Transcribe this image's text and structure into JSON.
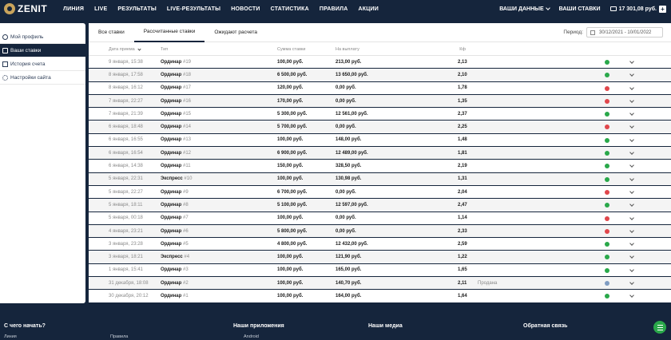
{
  "brand": {
    "name": "ZENIT"
  },
  "nav": [
    "ЛИНИЯ",
    "LIVE",
    "РЕЗУЛЬТАТЫ",
    "LIVE-РЕЗУЛЬТАТЫ",
    "НОВОСТИ",
    "СТАТИСТИКА",
    "ПРАВИЛА",
    "АКЦИИ"
  ],
  "header": {
    "my_data": "ВАШИ ДАННЫЕ",
    "my_bets": "ВАШИ СТАВКИ",
    "balance": "17 301,08 руб."
  },
  "sidebar": {
    "items": [
      {
        "label": "Мой профиль",
        "icon": "user-icon",
        "active": false
      },
      {
        "label": "Ваши ставки",
        "icon": "card-icon",
        "active": true
      },
      {
        "label": "История счета",
        "icon": "document-icon",
        "active": false
      },
      {
        "label": "Настройки сайта",
        "icon": "gear-icon",
        "active": false
      }
    ]
  },
  "tabs": [
    {
      "label": "Все ставки",
      "active": false
    },
    {
      "label": "Рассчитанные ставки",
      "active": true
    },
    {
      "label": "Ожидают расчета",
      "active": false
    }
  ],
  "period": {
    "label": "Период:",
    "value": "30/12/2021 - 10/01/2022"
  },
  "table": {
    "headers": {
      "date": "Дата приема",
      "type": "Тип",
      "amount": "Сумма ставки",
      "payout": "На выплату",
      "coef": "Кф"
    },
    "rows": [
      {
        "date": "9 января, 15:38",
        "type": "Ординар",
        "num": "#19",
        "amount": "100,00 руб.",
        "payout": "213,00 руб.",
        "coef": "2,13",
        "state": "",
        "status": "win"
      },
      {
        "date": "8 января, 17:58",
        "type": "Ординар",
        "num": "#18",
        "amount": "6 500,00 руб.",
        "payout": "13 650,00 руб.",
        "coef": "2,10",
        "state": "",
        "status": "win"
      },
      {
        "date": "8 января, 16:12",
        "type": "Ординар",
        "num": "#17",
        "amount": "120,00 руб.",
        "payout": "0,00 руб.",
        "coef": "1,78",
        "state": "",
        "status": "lose"
      },
      {
        "date": "7 января, 22:27",
        "type": "Ординар",
        "num": "#16",
        "amount": "170,00 руб.",
        "payout": "0,00 руб.",
        "coef": "1,35",
        "state": "",
        "status": "lose"
      },
      {
        "date": "7 января, 21:39",
        "type": "Ординар",
        "num": "#15",
        "amount": "5 300,00 руб.",
        "payout": "12 561,00 руб.",
        "coef": "2,37",
        "state": "",
        "status": "win"
      },
      {
        "date": "6 января, 18:48",
        "type": "Ординар",
        "num": "#14",
        "amount": "5 700,00 руб.",
        "payout": "0,00 руб.",
        "coef": "2,25",
        "state": "",
        "status": "lose"
      },
      {
        "date": "6 января, 16:55",
        "type": "Ординар",
        "num": "#13",
        "amount": "100,00 руб.",
        "payout": "148,00 руб.",
        "coef": "1,48",
        "state": "",
        "status": "win"
      },
      {
        "date": "6 января, 16:54",
        "type": "Ординар",
        "num": "#12",
        "amount": "6 900,00 руб.",
        "payout": "12 489,00 руб.",
        "coef": "1,81",
        "state": "",
        "status": "win"
      },
      {
        "date": "6 января, 14:38",
        "type": "Ординар",
        "num": "#11",
        "amount": "150,00 руб.",
        "payout": "328,50 руб.",
        "coef": "2,19",
        "state": "",
        "status": "win"
      },
      {
        "date": "5 января, 22:31",
        "type": "Экспресс",
        "num": "#10",
        "amount": "100,00 руб.",
        "payout": "130,98 руб.",
        "coef": "1,31",
        "state": "",
        "status": "win"
      },
      {
        "date": "5 января, 22:27",
        "type": "Ординар",
        "num": "#9",
        "amount": "6 700,00 руб.",
        "payout": "0,00 руб.",
        "coef": "2,04",
        "state": "",
        "status": "lose"
      },
      {
        "date": "5 января, 18:11",
        "type": "Ординар",
        "num": "#8",
        "amount": "5 100,00 руб.",
        "payout": "12 597,00 руб.",
        "coef": "2,47",
        "state": "",
        "status": "win"
      },
      {
        "date": "5 января, 00:18",
        "type": "Ординар",
        "num": "#7",
        "amount": "100,00 руб.",
        "payout": "0,00 руб.",
        "coef": "1,14",
        "state": "",
        "status": "lose"
      },
      {
        "date": "4 января, 23:21",
        "type": "Ординар",
        "num": "#6",
        "amount": "5 800,00 руб.",
        "payout": "0,00 руб.",
        "coef": "2,33",
        "state": "",
        "status": "lose"
      },
      {
        "date": "3 января, 23:28",
        "type": "Ординар",
        "num": "#5",
        "amount": "4 800,00 руб.",
        "payout": "12 432,00 руб.",
        "coef": "2,59",
        "state": "",
        "status": "win"
      },
      {
        "date": "3 января, 18:21",
        "type": "Экспресс",
        "num": "#4",
        "amount": "100,00 руб.",
        "payout": "121,90 руб.",
        "coef": "1,22",
        "state": "",
        "status": "win"
      },
      {
        "date": "1 января, 15:41",
        "type": "Ординар",
        "num": "#3",
        "amount": "100,00 руб.",
        "payout": "165,00 руб.",
        "coef": "1,65",
        "state": "",
        "status": "win"
      },
      {
        "date": "31 декабря, 18:08",
        "type": "Ординар",
        "num": "#2",
        "amount": "100,00 руб.",
        "payout": "140,70 руб.",
        "coef": "2,11",
        "state": "Продана",
        "status": "sold"
      },
      {
        "date": "30 декабря, 20:12",
        "type": "Ординар",
        "num": "#1",
        "amount": "100,00 руб.",
        "payout": "164,00 руб.",
        "coef": "1,64",
        "state": "",
        "status": "win"
      }
    ]
  },
  "footer": {
    "cols": [
      {
        "title": "С чего начать?",
        "sub": "Линия",
        "sub2": "Правила"
      },
      {
        "title": "Наши приложения",
        "sub": "Android"
      },
      {
        "title": "Наши медиа",
        "sub": ""
      },
      {
        "title": "Обратная связь",
        "sub": ""
      }
    ]
  },
  "colors": {
    "navy": "#15253c",
    "win": "#2aa84a",
    "lose": "#e0474c",
    "sold": "#7f9cc2"
  }
}
